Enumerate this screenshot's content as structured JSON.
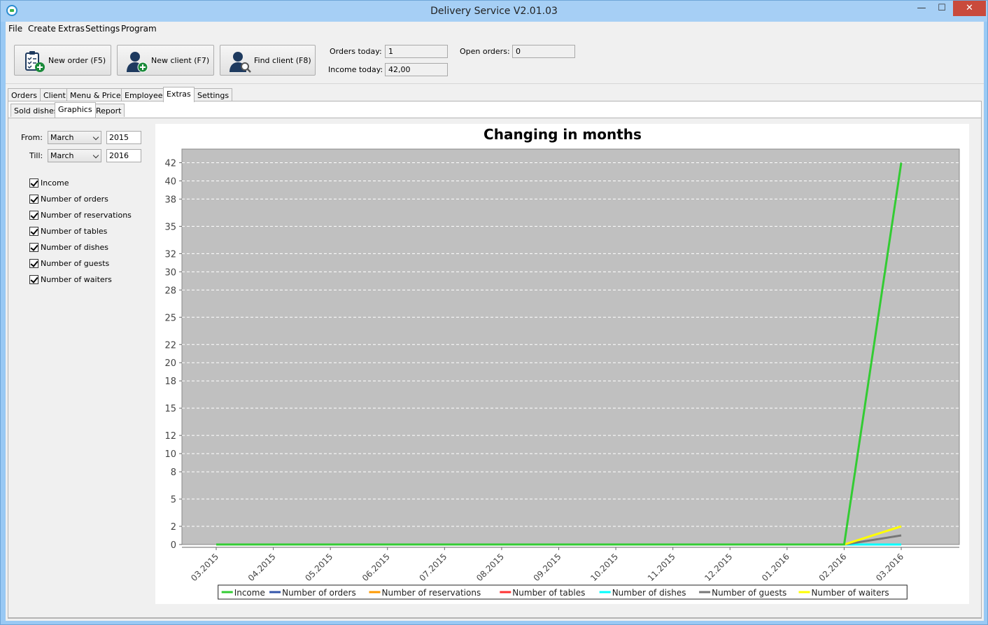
{
  "window": {
    "title": "Delivery Service V2.01.03",
    "min": "—",
    "max": "☐",
    "close": "✕"
  },
  "menu": [
    "File",
    "Create",
    "Extras",
    "Settings",
    "Program"
  ],
  "toolbar": {
    "new_order": "New order (F5)",
    "new_client": "New client (F7)",
    "find_client": "Find client (F8)",
    "orders_today_label": "Orders today:",
    "orders_today": "1",
    "income_today_label": "Income today:",
    "income_today": "42,00",
    "open_orders_label": "Open orders:",
    "open_orders": "0"
  },
  "tabs": [
    "Orders",
    "Client",
    "Menu & Prices",
    "Employees",
    "Extras",
    "Settings"
  ],
  "subtabs": [
    "Sold dishes",
    "Graphics",
    "Report"
  ],
  "filters": {
    "from_label": "From:",
    "from_month": "March",
    "from_year": "2015",
    "till_label": "Till:",
    "till_month": "March",
    "till_year": "2016"
  },
  "checkboxes": [
    "Income",
    "Number of orders",
    "Number of reservations",
    "Number of tables",
    "Number of dishes",
    "Number of guests",
    "Number of waiters"
  ],
  "chart_data": {
    "type": "line",
    "title": "Changing in months",
    "xlabel": "",
    "ylabel": "",
    "x": [
      "03.2015",
      "04.2015",
      "05.2015",
      "06.2015",
      "07.2015",
      "08.2015",
      "09.2015",
      "10.2015",
      "11.2015",
      "12.2015",
      "01.2016",
      "02.2016",
      "03.2016"
    ],
    "y_ticks": [
      "0",
      "2",
      "5",
      "8",
      "10",
      "12",
      "15",
      "18",
      "20",
      "22",
      "25",
      "28",
      "30",
      "32",
      "35",
      "38",
      "40",
      "42"
    ],
    "ylim": [
      0,
      43.5
    ],
    "grid": true,
    "legend_position": "bottom",
    "series": [
      {
        "name": "Income",
        "color": "#33cc33",
        "values": [
          0,
          0,
          0,
          0,
          0,
          0,
          0,
          0,
          0,
          0,
          0,
          0,
          42
        ]
      },
      {
        "name": "Number of orders",
        "color": "#3355aa",
        "values": [
          0,
          0,
          0,
          0,
          0,
          0,
          0,
          0,
          0,
          0,
          0,
          0,
          0
        ]
      },
      {
        "name": "Number of reservations",
        "color": "#ff9900",
        "values": [
          0,
          0,
          0,
          0,
          0,
          0,
          0,
          0,
          0,
          0,
          0,
          0,
          0
        ]
      },
      {
        "name": "Number of tables",
        "color": "#ff3333",
        "values": [
          0,
          0,
          0,
          0,
          0,
          0,
          0,
          0,
          0,
          0,
          0,
          0,
          0
        ]
      },
      {
        "name": "Number of dishes",
        "color": "#00ffff",
        "values": [
          0,
          0,
          0,
          0,
          0,
          0,
          0,
          0,
          0,
          0,
          0,
          0,
          0
        ]
      },
      {
        "name": "Number of guests",
        "color": "#777777",
        "values": [
          0,
          0,
          0,
          0,
          0,
          0,
          0,
          0,
          0,
          0,
          0,
          0,
          1
        ]
      },
      {
        "name": "Number of waiters",
        "color": "#ffff00",
        "values": [
          0,
          0,
          0,
          0,
          0,
          0,
          0,
          0,
          0,
          0,
          0,
          0,
          2
        ]
      }
    ]
  }
}
